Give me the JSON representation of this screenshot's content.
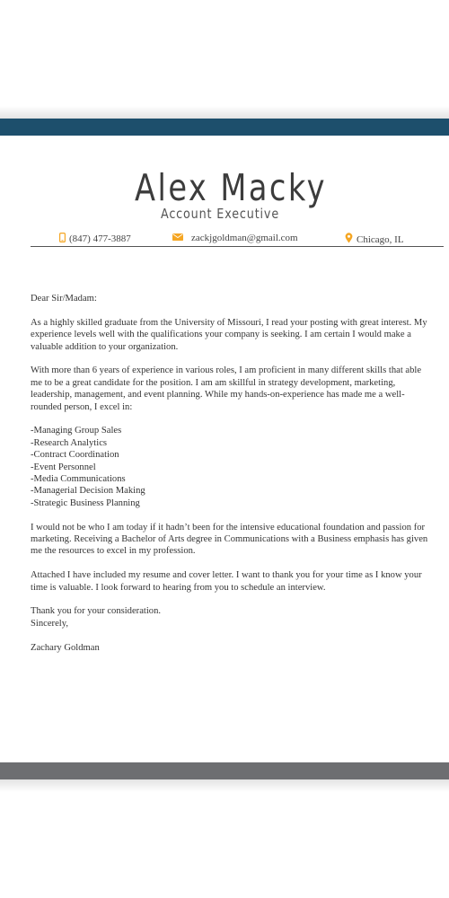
{
  "colors": {
    "header_band": "#1d4f6c",
    "footer_band": "#6d6e71",
    "icon_accent": "#f5a623"
  },
  "header": {
    "name": "Alex Macky",
    "title": "Account Executive"
  },
  "contact": {
    "phone": "(847) 477-3887",
    "phone_icon": "phone-icon",
    "email": "zackjgoldman@gmail.com",
    "email_icon": "envelope-icon",
    "location": "Chicago, IL",
    "location_icon": "map-pin-icon"
  },
  "letter": {
    "salutation": "Dear Sir/Madam:",
    "paragraph1": "As a highly skilled graduate from the University of Missouri, I read your posting with great interest.  My experience levels well with the qualifications your company is seeking.  I am certain I would make a valuable addition to your organization.",
    "paragraph2": "With more than 6 years of experience in various roles, I am proficient in many different skills that able me to be a great candidate for the position.  I am am skillful in strategy development, marketing, leadership, management, and event planning.  While my hands-on-experience has made me a well-rounded person, I excel in:",
    "skills": [
      "-Managing Group Sales",
      "-Research Analytics",
      "-Contract Coordination",
      "-Event Personnel",
      "-Media Communications",
      "-Managerial Decision Making",
      "-Strategic Business Planning"
    ],
    "paragraph3": "I would not be who I am today if it hadn’t been for the intensive educational foundation and passion for marketing.  Receiving a Bachelor of Arts degree in Communications with a Business emphasis has given me the resources to excel in my profession.",
    "paragraph4": "Attached I have included my resume and cover letter. I want to thank you for your time as I know your time is valuable.  I look forward to hearing from you to schedule an interview.",
    "thanks": "Thank you for your consideration.",
    "closing": "Sincerely,",
    "signature": "Zachary Goldman"
  }
}
